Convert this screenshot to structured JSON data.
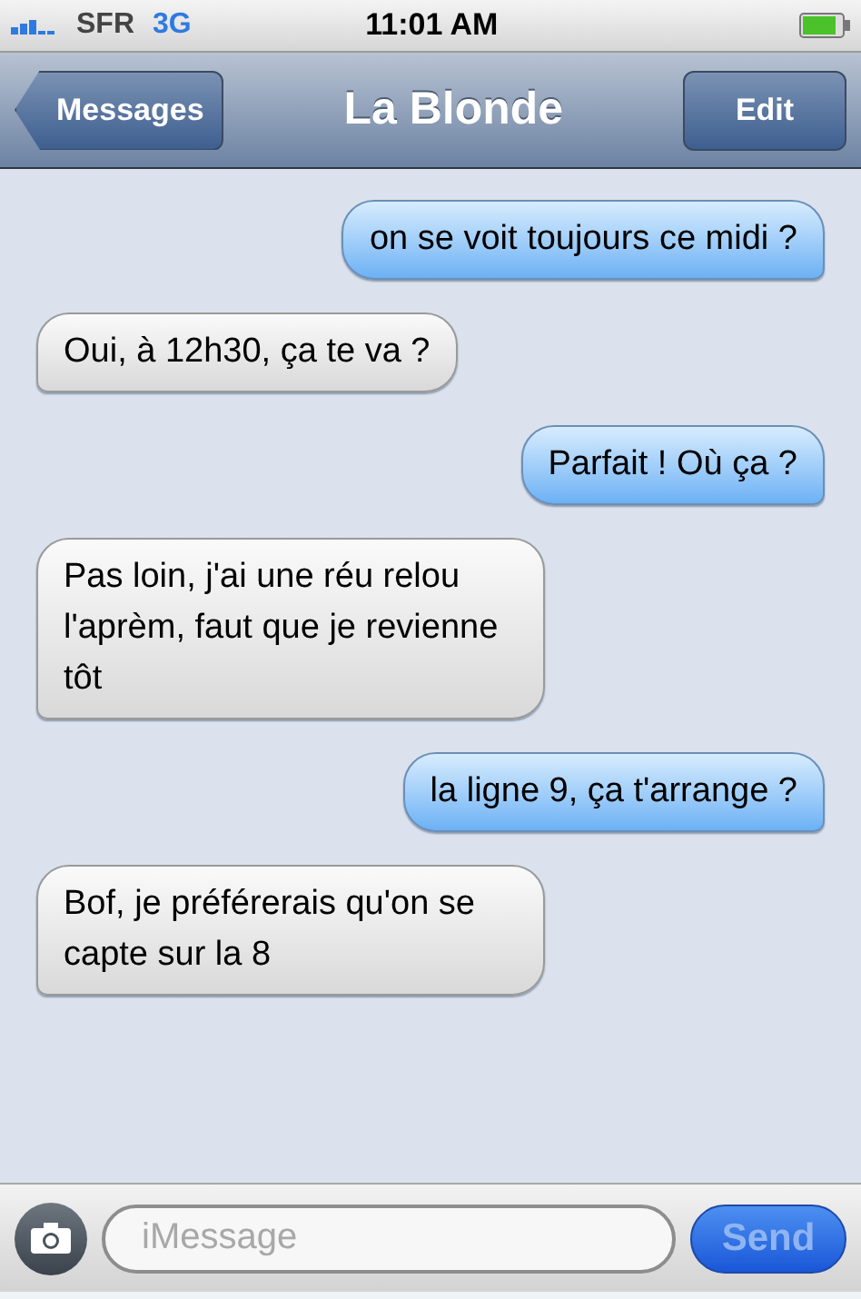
{
  "status_bar": {
    "carrier": "SFR",
    "network": "3G",
    "time": "11:01 AM"
  },
  "nav": {
    "back": "Messages",
    "title": "La Blonde",
    "edit": "Edit"
  },
  "messages": [
    {
      "text": "on se voit toujours ce midi ?",
      "sent": true
    },
    {
      "text": "Oui, à 12h30, ça te va ?",
      "sent": false
    },
    {
      "text": "Parfait ! Où ça ?",
      "sent": true
    },
    {
      "text": "Pas loin, j'ai une réu relou l'aprèm, faut que je revienne tôt",
      "sent": false
    },
    {
      "text": "la ligne 9, ça t'arrange ?",
      "sent": true
    },
    {
      "text": "Bof, je préférerais qu'on se capte sur la 8",
      "sent": false
    }
  ],
  "composer": {
    "placeholder": "iMessage",
    "send": "Send",
    "send_disabled": true
  }
}
